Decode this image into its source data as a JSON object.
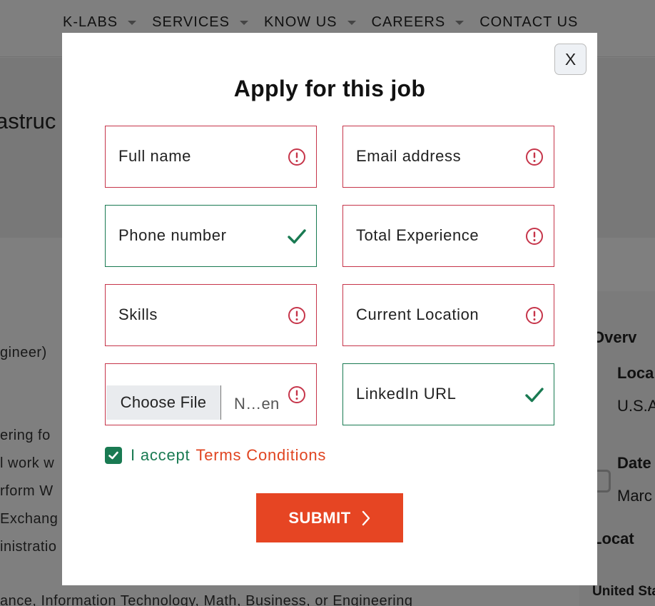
{
  "nav": {
    "items": [
      {
        "label": "K-LABS",
        "has_caret": true
      },
      {
        "label": "SERVICES",
        "has_caret": true
      },
      {
        "label": "KNOW US",
        "has_caret": true
      },
      {
        "label": "CAREERS",
        "has_caret": true
      },
      {
        "label": "CONTACT US",
        "has_caret": false
      }
    ]
  },
  "background": {
    "hero_title": "astruc",
    "body_lines": [
      "gineer)",
      "ering fo",
      "l work w",
      "rform W",
      "Exchang",
      "inistratio",
      "ance, Information Technology, Math, Business, or Engineering"
    ],
    "sidebar": {
      "job_overview": "Overv",
      "location_label": "Loca",
      "location_value": "U.S.A",
      "date_label": "Date",
      "date_value": "Marc",
      "job_location": "Locat",
      "country": "United Sta"
    }
  },
  "modal": {
    "close_label": "X",
    "title": "Apply for this job",
    "fields": {
      "full_name": {
        "placeholder": "Full name",
        "status": "error"
      },
      "email": {
        "placeholder": "Email address",
        "status": "error"
      },
      "phone": {
        "placeholder": "Phone number",
        "status": "valid"
      },
      "experience": {
        "placeholder": "Total Experience",
        "status": "error"
      },
      "skills": {
        "placeholder": "Skills",
        "status": "error"
      },
      "location": {
        "placeholder": "Current Location",
        "status": "error"
      },
      "resume": {
        "button_label": "Choose File",
        "file_name": "N…en",
        "status": "error"
      },
      "linkedin": {
        "placeholder": "LinkedIn URL",
        "status": "valid"
      }
    },
    "terms": {
      "text": "I accept",
      "link": "Terms Conditions",
      "checked": true
    },
    "submit_label": "SUBMIT"
  },
  "colors": {
    "error": "#c6354a",
    "valid": "#197a52",
    "accent": "#e64523",
    "link": "#e04420"
  }
}
